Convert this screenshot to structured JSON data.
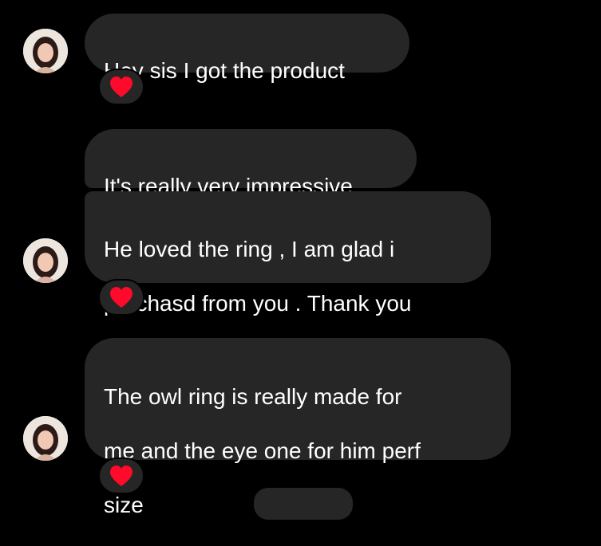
{
  "colors": {
    "background": "#000000",
    "bubble": "#262626",
    "text": "#ffffff",
    "heart": "#ff0a2a"
  },
  "contact": {
    "avatar_icon": "profile-photo-avatar"
  },
  "messages": [
    {
      "lines": [
        "Hey sis I got the product"
      ],
      "reaction": "heart-icon"
    },
    {
      "lines": [
        "It's really very impressive"
      ]
    },
    {
      "lines": [
        "He loved the  ring , I am glad i",
        "purchasd from you . Thank you"
      ],
      "reaction": "heart-icon"
    },
    {
      "lines": [
        "The owl ring is really made for",
        "me and the eye one for him perf",
        "size"
      ],
      "reaction": "heart-icon"
    }
  ]
}
